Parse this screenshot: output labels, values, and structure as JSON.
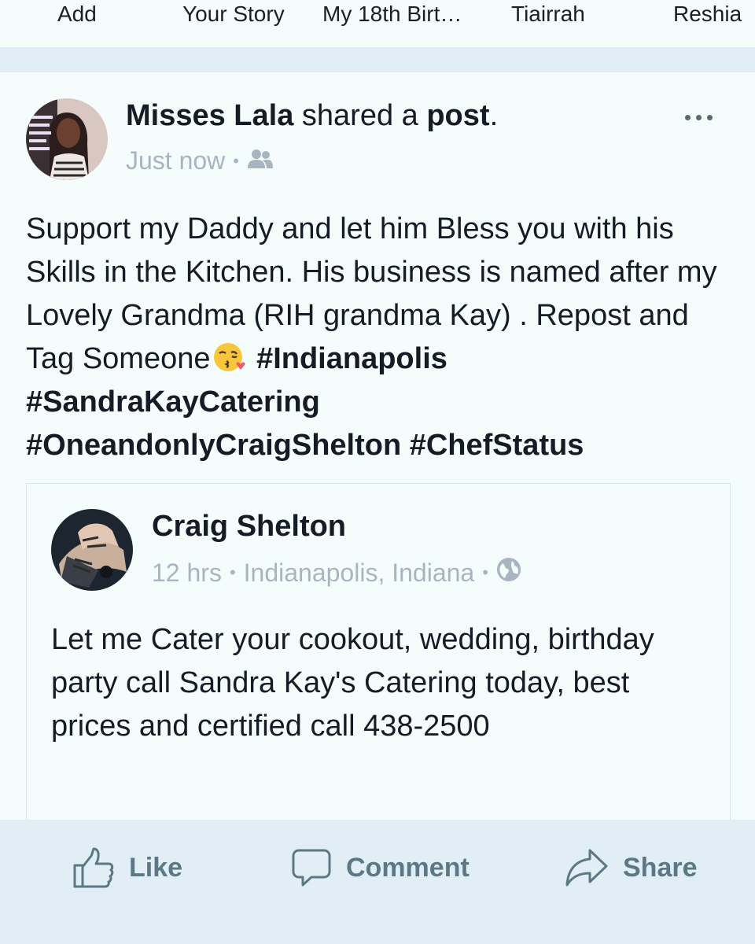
{
  "stories": [
    {
      "label": "Add"
    },
    {
      "label": "Your Story"
    },
    {
      "label": "My 18th Birt…"
    },
    {
      "label": "Tiairrah"
    },
    {
      "label": "Reshia"
    }
  ],
  "post": {
    "author": "Misses Lala",
    "action_text": " shared a ",
    "action_object": "post",
    "action_end": ".",
    "time": "Just now",
    "separator": "•",
    "audience_icon": "friends-icon",
    "more_icon": "more-dots-icon",
    "text_line1": "Support my Daddy and let him Bless you with his Skills in the Kitchen. His business is named after my Lovely Grandma (RIH grandma Kay) . Repost and Tag Someone",
    "emoji": "kissing-face-with-heart-emoji",
    "hashtags": [
      "#Indianapolis",
      "#SandraKayCatering",
      "#OneandonlyCraigShelton",
      "#ChefStatus"
    ]
  },
  "shared": {
    "author": "Craig Shelton",
    "time": "12 hrs",
    "separator": "•",
    "location": "Indianapolis, Indiana",
    "audience_icon": "globe-icon",
    "text": "Let me Cater your cookout,  wedding, birthday party call Sandra Kay's  Catering today,  best prices and certified call 438-2500"
  },
  "actions": {
    "like": "Like",
    "comment": "Comment",
    "share": "Share"
  },
  "colors": {
    "background": "#f4fdfc",
    "bar": "#e2eef6",
    "meta_text": "#a9b4c1",
    "action_text": "#5b7884"
  }
}
